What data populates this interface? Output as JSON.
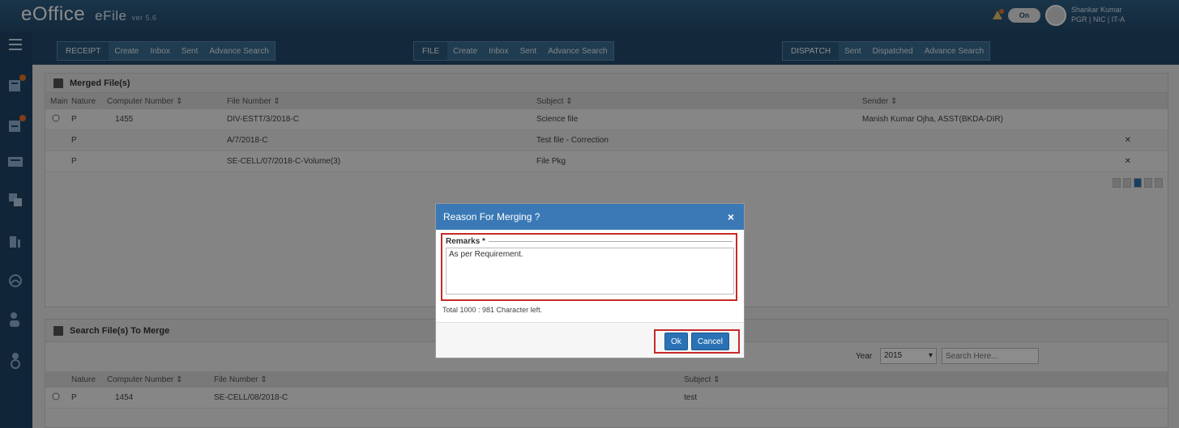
{
  "header": {
    "logo_brand": "eOffice",
    "logo_product": "eFile",
    "logo_version": "ver 5.6",
    "logo_sub": "",
    "toggle_label": "On",
    "user_name": "Shankar Kumar",
    "user_role": "PGR | NIC | IT-A"
  },
  "menu": {
    "receipt": {
      "label": "RECEIPT",
      "items": [
        "Create",
        "Inbox",
        "Sent",
        "Advance Search"
      ]
    },
    "file": {
      "label": "FILE",
      "items": [
        "Create",
        "Inbox",
        "Sent",
        "Advance Search"
      ]
    },
    "dispatch": {
      "label": "DISPATCH",
      "items": [
        "Sent",
        "Dispatched",
        "Advance Search"
      ]
    }
  },
  "merged_panel": {
    "title": "Merged File(s)",
    "columns": [
      "Main",
      "Nature",
      "Computer Number ⇕",
      "File Number ⇕",
      "Subject ⇕",
      "Sender ⇕"
    ],
    "rows": [
      {
        "nature": "P",
        "computer_number": "1455",
        "file_number": "DIV-ESTT/3/2018-C",
        "subject": "Science file",
        "sender": "Manish Kumar Ojha, ASST(BKDA-DIR)"
      },
      {
        "nature": "P",
        "computer_number": "",
        "file_number": "A/7/2018-C",
        "subject": "Test file - Correction",
        "sender": ""
      },
      {
        "nature": "P",
        "computer_number": "",
        "file_number": "SE-CELL/07/2018-C-Volume(3)",
        "subject": "File Pkg",
        "sender": ""
      }
    ]
  },
  "search_panel": {
    "title": "Search File(s) To Merge",
    "year_label": "Year",
    "year_value": "2015",
    "search_placeholder": "Search Here...",
    "columns": [
      "Nature",
      "Computer Number ⇕",
      "File Number ⇕",
      "Subject ⇕"
    ],
    "rows": [
      {
        "nature": "P",
        "computer_number": "1454",
        "file_number": "SE-CELL/08/2018-C",
        "subject": "test"
      }
    ]
  },
  "modal": {
    "title": "Reason For Merging ?",
    "close_label": "×",
    "remarks_label": "Remarks *",
    "remarks_value": "As per Requirement.",
    "char_count": "Total 1000 : 981 Character left.",
    "ok_label": "Ok",
    "cancel_label": "Cancel"
  },
  "colors": {
    "header_bg": "#234b6c",
    "modal_header": "#3a79b5",
    "highlight_border": "#c72a2a",
    "button": "#2a72b5"
  }
}
